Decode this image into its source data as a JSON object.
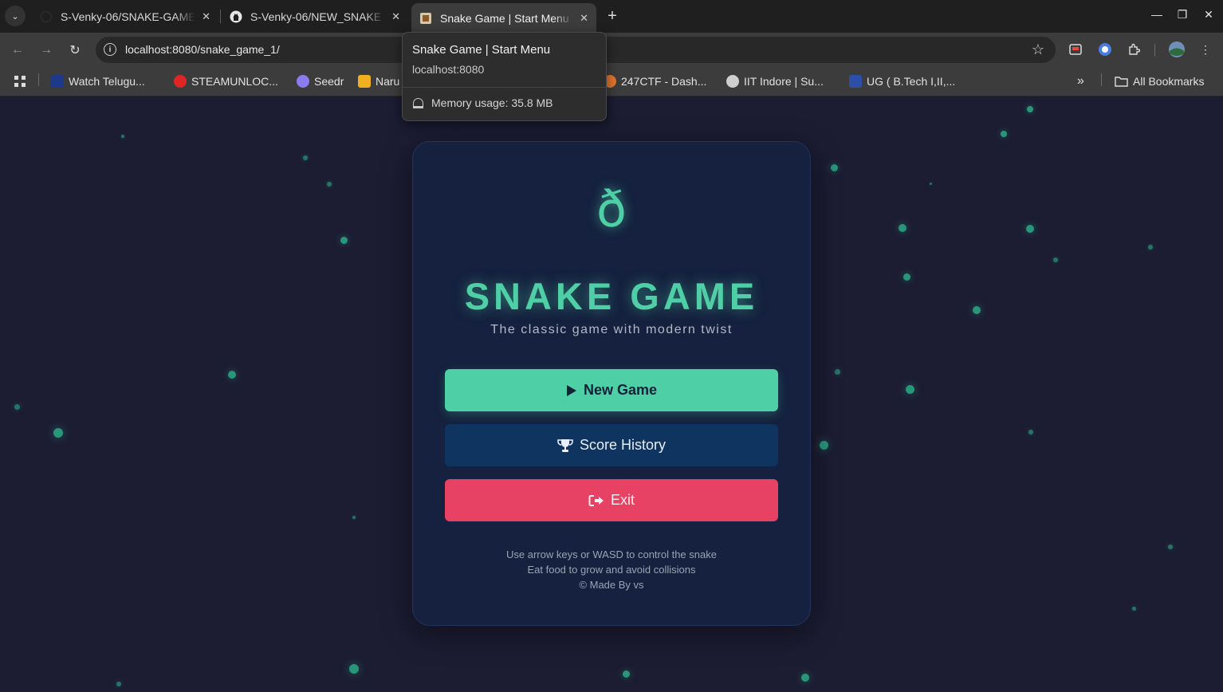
{
  "browser": {
    "tabs": [
      {
        "title": "S-Venky-06/SNAKE-GAME",
        "icon": "github-icon"
      },
      {
        "title": "S-Venky-06/NEW_SNAKE",
        "icon": "github-icon"
      },
      {
        "title": "Snake Game | Start Menu",
        "icon": "page-favicon",
        "active": true
      }
    ],
    "url": "localhost:8080/snake_game_1/",
    "bookmarks": [
      {
        "label": "Watch Telugu...",
        "color": "#1d3a8a"
      },
      {
        "label": "STEAMUNLOC...",
        "color": "#e02525"
      },
      {
        "label": "Seedr",
        "color": "#8a7cf0"
      },
      {
        "label": "Naru",
        "color": "#f0b020"
      },
      {
        "label": "247CTF - Dash...",
        "color": "#e0742b"
      },
      {
        "label": "IIT Indore | Su...",
        "color": "#cfcfcf"
      },
      {
        "label": "UG ( B.Tech I,II,...",
        "color": "#2c4fa8"
      }
    ],
    "all_bookmarks_label": "All Bookmarks",
    "hover_card": {
      "title": "Snake Game | Start Menu",
      "host": "localhost:8080",
      "memory": "Memory usage: 35.8 MB"
    }
  },
  "game": {
    "logo_glyph": "ð",
    "title": "SNAKE GAME",
    "subtitle": "The classic game with modern twist",
    "buttons": {
      "new_game": "New Game",
      "score_history": "Score History",
      "exit": "Exit"
    },
    "instructions": [
      "Use arrow keys or WASD to control the snake",
      "Eat food to grow and avoid collisions",
      "© Made By vs"
    ],
    "colors": {
      "accent": "#4ecfa5",
      "background": "#1c1c33",
      "card": "#15213e",
      "score_button": "#0f3460",
      "exit_button": "#e74164"
    }
  }
}
